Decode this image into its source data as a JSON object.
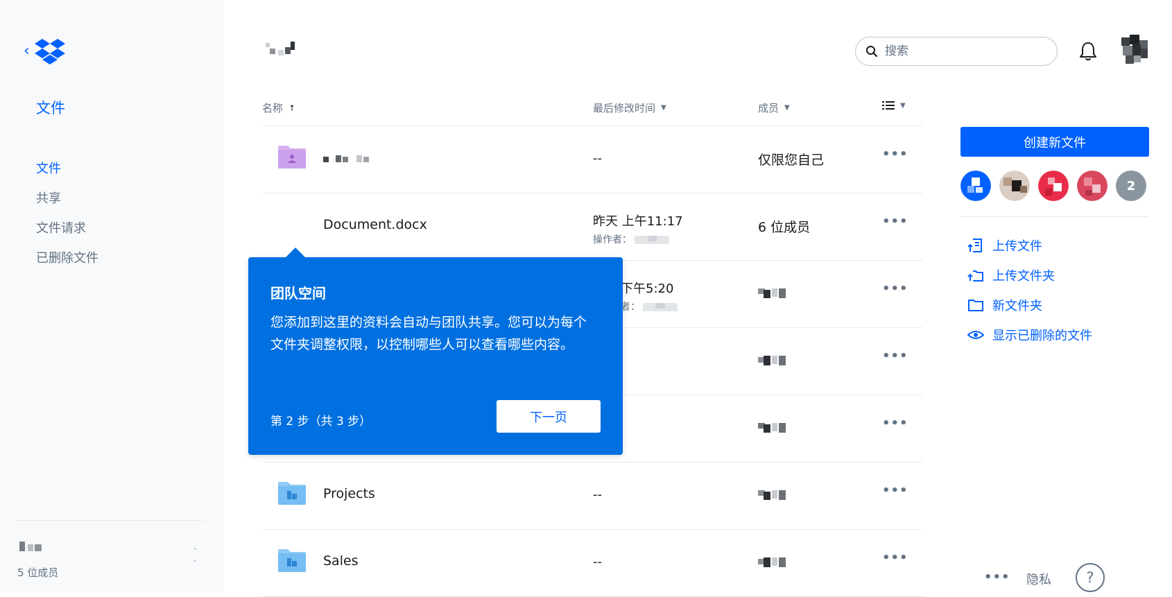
{
  "sidebar": {
    "title": "文件",
    "items": [
      {
        "label": "文件",
        "active": true
      },
      {
        "label": "共享",
        "active": false
      },
      {
        "label": "文件请求",
        "active": false
      },
      {
        "label": "已删除文件",
        "active": false
      }
    ],
    "team_members": "5 位成员"
  },
  "header": {
    "search_placeholder": "搜索"
  },
  "table": {
    "columns": {
      "name": "名称",
      "modified": "最后修改时间",
      "members": "成员"
    },
    "rows": [
      {
        "name": "",
        "modified": "--",
        "modified_by_label": "",
        "members": "仅限您自己",
        "icon": "folder-shared-purple-icon"
      },
      {
        "name": "Document.docx",
        "modified": "昨天 上午11:17",
        "modified_by_label": "操作者：",
        "members": "6 位成员",
        "icon": "docx-icon"
      },
      {
        "name": "",
        "modified": "下午5:20",
        "modified_by_label": "者：",
        "members": "",
        "icon": "folder-icon"
      },
      {
        "name": "",
        "modified": "",
        "modified_by_label": "",
        "members": "",
        "icon": "folder-icon"
      },
      {
        "name": "",
        "modified": "",
        "modified_by_label": "",
        "members": "",
        "icon": "folder-icon"
      },
      {
        "name": "Projects",
        "modified": "--",
        "modified_by_label": "",
        "members": "",
        "icon": "folder-team-icon"
      },
      {
        "name": "Sales",
        "modified": "--",
        "modified_by_label": "",
        "members": "",
        "icon": "folder-team-icon"
      }
    ],
    "more_label": "•••"
  },
  "right_panel": {
    "create_label": "创建新文件",
    "member_overflow": "2",
    "actions": [
      {
        "label": "上传文件",
        "icon": "upload-file-icon"
      },
      {
        "label": "上传文件夹",
        "icon": "upload-folder-icon"
      },
      {
        "label": "新文件夹",
        "icon": "new-folder-icon"
      },
      {
        "label": "显示已删除的文件",
        "icon": "eye-icon"
      }
    ]
  },
  "footer": {
    "more": "•••",
    "privacy": "隐私",
    "help": "?"
  },
  "tour": {
    "title": "团队空间",
    "body": "您添加到这里的资料会自动与团队共享。您可以为每个文件夹调整权限，以控制哪些人可以查看哪些内容。",
    "step": "第 2 步（共 3 步）",
    "next_label": "下一页"
  },
  "colors": {
    "accent": "#0061fe",
    "tour_bg": "#0070e0",
    "text_muted": "#637282"
  }
}
